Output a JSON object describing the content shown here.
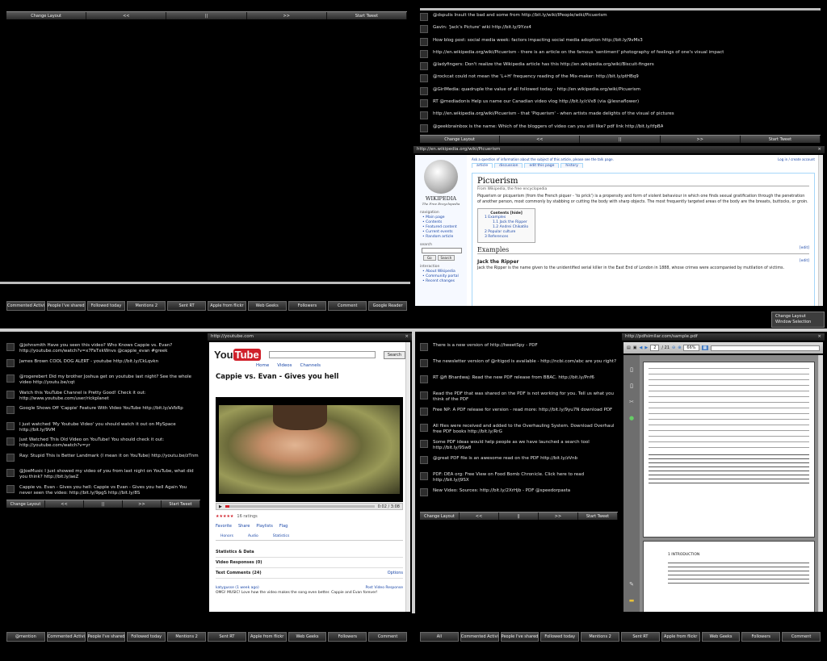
{
  "common": {
    "change_layout": "Change Layout",
    "prev": "<<",
    "mid": "||",
    "next": ">>",
    "start_tweet": "Start Tweet"
  },
  "top_left": {
    "tabs": [
      "Commented Activity",
      "People I've shared",
      "Followed today",
      "Mentions 2",
      "Sent RT",
      "Apple from flickr",
      "Web Geeks",
      "Followers",
      "Comment",
      "Google Reader"
    ]
  },
  "top_right_feed": [
    "@dspulis Insult the bad and some from http://bit.ly/wiki/IPeople/wiki/Picuerism",
    "Gavin: 'Jack's Picture' wiki http://bit.ly/9Yzx4",
    "How blog post: social media week: factors impacting social media adoption http://bit.ly/9vMs3",
    "http://en.wikipedia.org/wiki/Picuerism - there is an article on the famous 'sentiment' photography of feelings of one's visual impact",
    "@ladyfingers: Don't realize the Wikipedia article has this http://en.wikipedia.org/wiki/Biscuit-fingers",
    "@rockcat could not mean the 'L+H' frequency reading of the Mix-maker: http://bit.ly/ptHBq9",
    "@GirlMedia: quadruple the value of all followed today - http://en.wikipedia.org/wiki/Picuerism",
    "RT @mediadonis Help us name our Canadian video vlog http://bit.ly/cVx8 (via @lesnaflower)",
    "http://en.wikipedia.org/wiki/Picuerism - that 'Piquerism' - when artists made delights of the visual of pictures",
    "@geekbrainbox is the name: Which of the bloggers of video can you still like? pdf link http://bit.ly/tfpBA"
  ],
  "wiki": {
    "window_title": "http://en.wikipedia.org/wiki/Picuerism",
    "notice": "Ask a question of information about the subject of this article, please see the talk page.",
    "login": "Log in / create account",
    "tabs": [
      "article",
      "discussion",
      "edit this page",
      "history"
    ],
    "wordmark": "WIKIPEDIA",
    "tagline": "The Free Encyclopedia",
    "nav_heading": "navigation",
    "nav": [
      "Main page",
      "Contents",
      "Featured content",
      "Current events",
      "Random article"
    ],
    "search_heading": "search",
    "search_go": "Go",
    "search_btn": "Search",
    "interaction_heading": "interaction",
    "interaction": [
      "About Wikipedia",
      "Community portal",
      "Recent changes"
    ],
    "title": "Picuerism",
    "from": "From Wikipedia, the free encyclopedia",
    "body": "Piquerism or picquerism (from the French piquer - 'to prick') is a propensity and form of violent behaviour in which one finds sexual gratification through the penetration of another person, most commonly by stabbing or cutting the body with sharp objects. The most frequently targeted areas of the body are the breasts, buttocks, or groin.",
    "toc_title": "Contents [hide]",
    "toc": [
      "1 Examples",
      "1.1 Jack the Ripper",
      "1.2 Andrei Chikatilo",
      "2 Popular culture",
      "3 References"
    ],
    "examples": "Examples",
    "edit": "[edit]",
    "jack": "Jack the Ripper",
    "jack_text": "Jack the Ripper is the name given to the unidentified serial killer in the East End of London in 1888, whose crimes were accompanied by mutilation of victims."
  },
  "wiki_tooltip": {
    "line1": "Change Layout",
    "line2": "Window Selection"
  },
  "mid_left_feed": [
    "@johnsmith Have you seen this video? Who Knows Cappie vs. Evan? http://youtube.com/watch?v=x7FaTxkWnvs @cappie_evan #greek",
    "James Brown COOL DOG ALERT - youtube http://bit.ly/CkLqvkn",
    "@rogerebert Did my brother Joshua get on youtube last night? See the whole video http://youtu.be/cqt",
    "Watch this YouTube Channel is Pretty Good! Check it out: http://www.youtube.com/user/rickplanet",
    "Google Shows Off 'Cappie' Feature With Video YouTube http://bit.ly/aVbRp",
    "I just watched 'My Youtube Video' you should watch it out on MySpace http://bit.ly/9VM",
    "Just Watched This Old Video on YouTube! You should check it out: http://youtube.com/watch?v=yr",
    "Ray: Stupid This is Better Landmark (I mean it on YouTube) http://youtu.be/zTnm",
    "@JoeMusic I just showed my video of you from last night on YouTube, what did you think? http://bit.ly/aeZ",
    "Cappie vs. Evan - Gives you hell: Cappie vs Evan - Gives you hell Again You never seen the video: http://bit.ly/9pgS http://bit.ly/8S"
  ],
  "youtube": {
    "window_title": "http://youtube.com",
    "search_btn": "Search",
    "nav": [
      "Home",
      "Videos",
      "Channels"
    ],
    "title": "Cappie vs. Evan - Gives you hell",
    "time": "0:02 / 3:08",
    "ratings": "16 ratings",
    "actions": [
      "Favorite",
      "Share",
      "Playlists",
      "Flag"
    ],
    "subtabs": [
      "Honors",
      "Audio",
      "Statistics"
    ],
    "sections": [
      "Statistics & Data",
      "Video Responses (0)",
      "Text Comments (24)"
    ],
    "options": "Options",
    "post_video": "Post Video Response",
    "comment_user": "katygusse (1 week ago)",
    "comment_text": "OMG! MUSIC! Love how the video makes the song even better. Cappie and Evan forever!"
  },
  "mid_right_feed": [
    "There is a new version of http://tweetSpy - PDF",
    "The newsletter version of @ritigod is available - http://ncbi.com/abc are you right?",
    "RT @fi Bhardwaj: Read the new PDF release from BBAC. http://bit.ly/Pnf6",
    "Read the PDF that was shared on the PDF is not working for you. Tell us what you think of the PDF",
    "Free NP: A PDF release for version - read more: http://bit.ly/9yu7N  download PDF",
    "All files were received and added to the Overhauling System. Download Overhaul free PDF books http://bit.ly/RrG",
    "Some PDF ideas would help people as we have launched a search tool http://bit.ly/9Sw8",
    "@great PDF file is an awesome read on the PDF http://bit.ly/zVnb",
    "PDF: DEA org: Free View on Food Bomb Chronicle. Click here to read http://bit.ly/j9SX",
    "New Video: Sources: http://bit.ly/2XrHjb - PDF @speedorpasta"
  ],
  "pdf": {
    "window_title": "http://pdfsimilar.com/sample.pdf",
    "page": "2",
    "of": "/ 21",
    "zoom": "66%",
    "find": "Find",
    "intro_heading": "1 INTRODUCTION"
  },
  "bottom_left_tabs": [
    "@mention",
    "Commented Activity",
    "People I've shared",
    "Followed today",
    "Mentions 2",
    "Sent RT",
    "Apple from flickr",
    "Web Geeks",
    "Followers",
    "Comment"
  ],
  "bottom_right_tabs": [
    "All",
    "Commented Activity",
    "People I've shared",
    "Followed today",
    "Mentions 2",
    "Sent RT",
    "Apple from flickr",
    "Web Geeks",
    "Followers",
    "Comment"
  ]
}
